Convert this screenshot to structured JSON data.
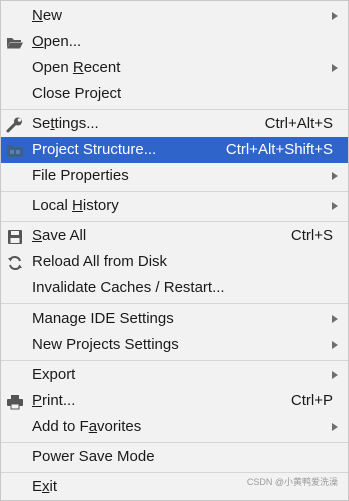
{
  "menu": {
    "items": [
      {
        "label_pre": "",
        "label_mn": "N",
        "label_post": "ew",
        "shortcut": "",
        "submenu": true
      },
      {
        "label_pre": "",
        "label_mn": "O",
        "label_post": "pen...",
        "shortcut": "",
        "submenu": false,
        "icon": "folder-open-icon"
      },
      {
        "label_pre": "Open ",
        "label_mn": "R",
        "label_post": "ecent",
        "shortcut": "",
        "submenu": true
      },
      {
        "label_pre": "Close Project",
        "label_mn": "",
        "label_post": "",
        "shortcut": "",
        "submenu": false
      },
      {
        "label_pre": "Se",
        "label_mn": "t",
        "label_post": "tings...",
        "shortcut": "Ctrl+Alt+S",
        "submenu": false,
        "icon": "wrench-icon"
      },
      {
        "label_pre": "Project Structure...",
        "label_mn": "",
        "label_post": "",
        "shortcut": "Ctrl+Alt+Shift+S",
        "submenu": false,
        "icon": "project-structure-icon",
        "selected": true
      },
      {
        "label_pre": "File Properties",
        "label_mn": "",
        "label_post": "",
        "shortcut": "",
        "submenu": true
      },
      {
        "label_pre": "Local ",
        "label_mn": "H",
        "label_post": "istory",
        "shortcut": "",
        "submenu": true
      },
      {
        "label_pre": "",
        "label_mn": "S",
        "label_post": "ave All",
        "shortcut": "Ctrl+S",
        "submenu": false,
        "icon": "save-icon"
      },
      {
        "label_pre": "Reload All from Disk",
        "label_mn": "",
        "label_post": "",
        "shortcut": "",
        "submenu": false,
        "icon": "reload-icon"
      },
      {
        "label_pre": "Invalidate Caches / Restart...",
        "label_mn": "",
        "label_post": "",
        "shortcut": "",
        "submenu": false
      },
      {
        "label_pre": "Manage IDE Settings",
        "label_mn": "",
        "label_post": "",
        "shortcut": "",
        "submenu": true
      },
      {
        "label_pre": "New Projects Settings",
        "label_mn": "",
        "label_post": "",
        "shortcut": "",
        "submenu": true
      },
      {
        "label_pre": "Export",
        "label_mn": "",
        "label_post": "",
        "shortcut": "",
        "submenu": true
      },
      {
        "label_pre": "",
        "label_mn": "P",
        "label_post": "rint...",
        "shortcut": "Ctrl+P",
        "submenu": false,
        "icon": "printer-icon"
      },
      {
        "label_pre": "Add to F",
        "label_mn": "a",
        "label_post": "vorites",
        "shortcut": "",
        "submenu": true
      },
      {
        "label_pre": "Power Save Mode",
        "label_mn": "",
        "label_post": "",
        "shortcut": "",
        "submenu": false
      },
      {
        "label_pre": "E",
        "label_mn": "x",
        "label_post": "it",
        "shortcut": "",
        "submenu": false
      }
    ]
  },
  "watermark": "CSDN @小黄鸭爱洗澡",
  "colors": {
    "menu_bg": "#f2f2f2",
    "selected_bg": "#2f65ca",
    "selected_text": "#ffffff",
    "separator": "#d6d6d6",
    "text": "#1a1a1a"
  }
}
